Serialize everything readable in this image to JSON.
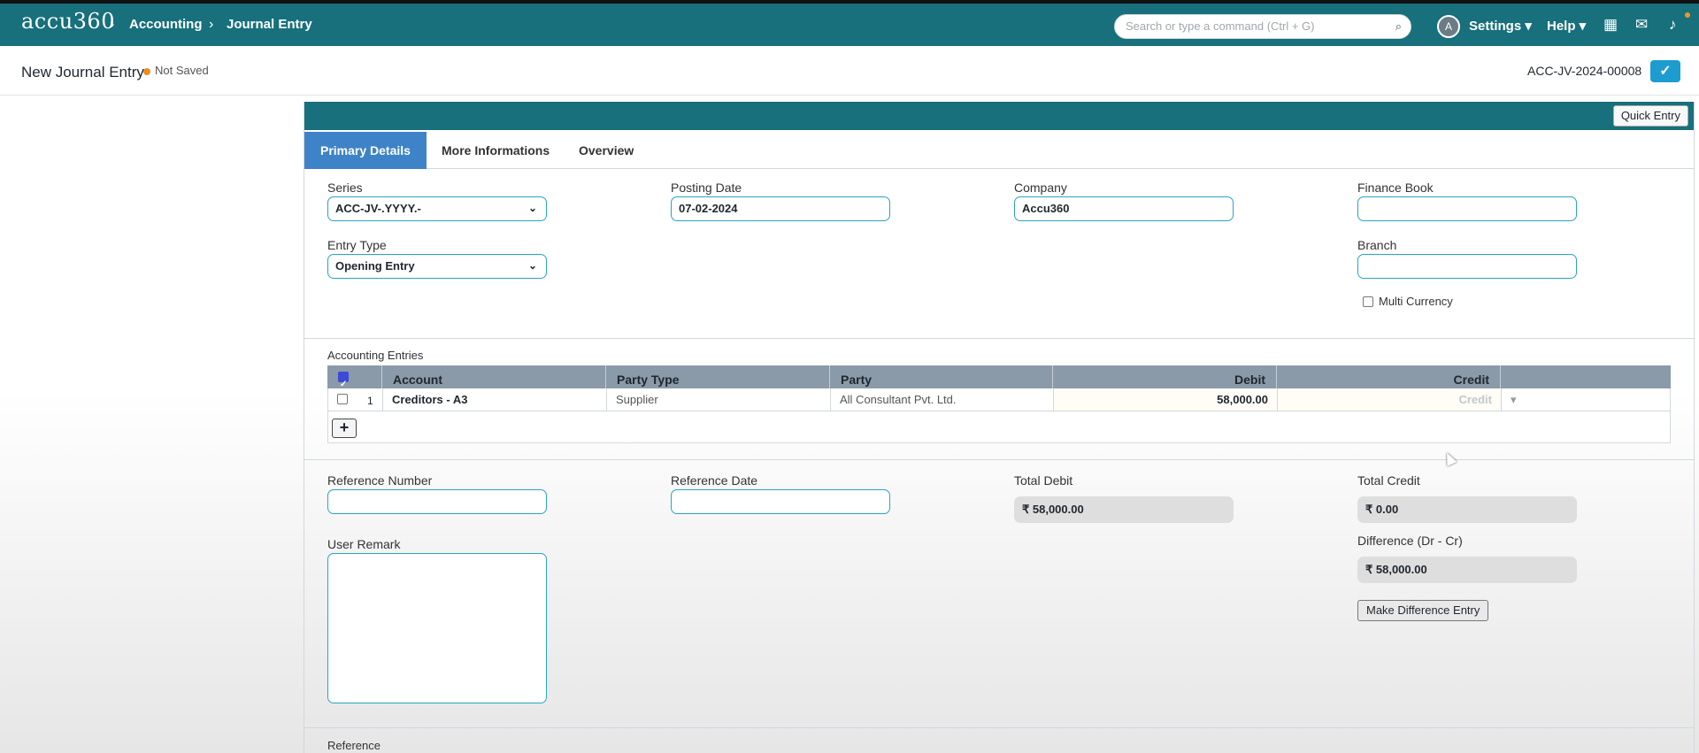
{
  "topbar": {
    "logo": "accu360",
    "breadcrumbs": [
      "Accounting",
      "Journal Entry"
    ],
    "search_placeholder": "Search or type a command (Ctrl + G)",
    "avatar_letter": "A",
    "settings_label": "Settings",
    "help_label": "Help"
  },
  "page": {
    "title": "New Journal Entry",
    "status": "Not Saved",
    "doc_name": "ACC-JV-2024-00008",
    "save_icon": "✓"
  },
  "form": {
    "quick_entry_label": "Quick Entry",
    "tabs": [
      "Primary Details",
      "More Informations",
      "Overview"
    ],
    "series_label": "Series",
    "series_value": "ACC-JV-.YYYY.-",
    "posting_date_label": "Posting Date",
    "posting_date_value": "07-02-2024",
    "company_label": "Company",
    "company_value": "Accu360",
    "finance_book_label": "Finance Book",
    "finance_book_value": "",
    "entry_type_label": "Entry Type",
    "entry_type_value": "Opening Entry",
    "branch_label": "Branch",
    "branch_value": "",
    "multi_currency_label": "Multi Currency"
  },
  "accounting": {
    "section_label": "Accounting Entries",
    "columns": [
      "Account",
      "Party Type",
      "Party",
      "Debit",
      "Credit"
    ],
    "rows": [
      {
        "idx": "1",
        "account": "Creditors - A3",
        "party_type": "Supplier",
        "party": "All Consultant Pvt. Ltd.",
        "debit": "58,000.00",
        "credit": "Credit"
      }
    ],
    "add_row_label": "+"
  },
  "totals": {
    "reference_number_label": "Reference Number",
    "reference_date_label": "Reference Date",
    "total_debit_label": "Total Debit",
    "total_debit_value": "₹ 58,000.00",
    "total_credit_label": "Total Credit",
    "total_credit_value": "₹ 0.00",
    "difference_label": "Difference (Dr - Cr)",
    "difference_value": "₹ 58,000.00",
    "make_difference_label": "Make Difference Entry",
    "user_remark_label": "User Remark",
    "reference_section_label": "Reference"
  }
}
